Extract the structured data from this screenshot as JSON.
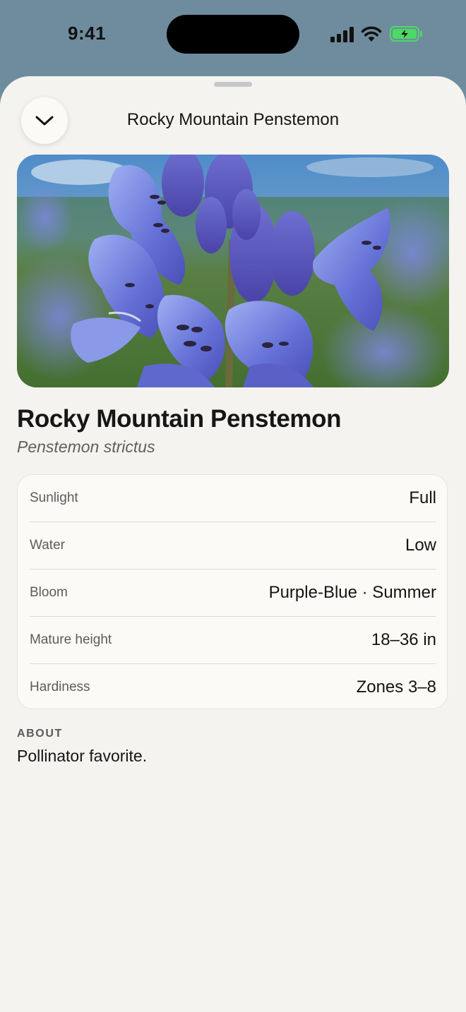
{
  "status_bar": {
    "time": "9:41"
  },
  "sheet": {
    "title": "Rocky Mountain Penstemon"
  },
  "hero": {
    "image_subject": "blue-purple penstemon flowers"
  },
  "plant": {
    "common_name": "Rocky Mountain Penstemon",
    "scientific_name": "Penstemon strictus"
  },
  "details": [
    {
      "label": "Sunlight",
      "value": "Full"
    },
    {
      "label": "Water",
      "value": "Low"
    },
    {
      "label": "Bloom",
      "value": "Purple-Blue · Summer"
    },
    {
      "label": "Mature height",
      "value": "18–36 in"
    },
    {
      "label": "Hardiness",
      "value": "Zones 3–8"
    }
  ],
  "about": {
    "heading": "ABOUT",
    "text": "Pollinator favorite."
  },
  "icons": {
    "collapse": "chevron-down-icon",
    "signal": "cellular-signal-icon",
    "wifi": "wifi-icon",
    "battery": "battery-charging-icon"
  },
  "colors": {
    "sheet_background": "#f4f3f0",
    "card_background": "#fbfaf7",
    "battery_green": "#4cd964",
    "backdrop": "#6f8c9e"
  }
}
